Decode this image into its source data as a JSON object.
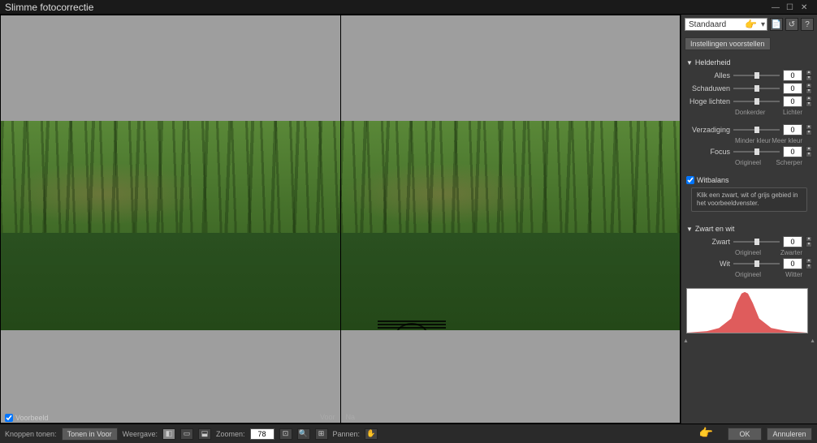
{
  "window": {
    "title": "Slimme fotocorrectie"
  },
  "preset": {
    "selected": "Standaard",
    "save_label": "Instellingen voorstellen"
  },
  "sections": {
    "brightness": {
      "title": "Helderheid",
      "all": {
        "label": "Alles",
        "value": "0"
      },
      "shadows": {
        "label": "Schaduwen",
        "value": "0"
      },
      "highlights": {
        "label": "Hoge lichten",
        "value": "0"
      },
      "range_low": "Donkerder",
      "range_high": "Lichter"
    },
    "saturation": {
      "label": "Verzadiging",
      "value": "0",
      "range_low": "Minder kleur",
      "range_high": "Meer kleur"
    },
    "focus": {
      "label": "Focus",
      "value": "0",
      "range_low": "Origineel",
      "range_high": "Scherper"
    },
    "wb": {
      "title": "Witbalans",
      "hint": "Klik een zwart, wit of grijs gebied in het voorbeeldvenster."
    },
    "bw": {
      "title": "Zwart en wit",
      "black": {
        "label": "Zwart",
        "value": "0",
        "range_low": "Origineel",
        "range_high": "Zwarter"
      },
      "white": {
        "label": "Wit",
        "value": "0",
        "range_low": "Origineel",
        "range_high": "Witter"
      }
    }
  },
  "image": {
    "before_label": "Voor",
    "after_label": "Na"
  },
  "footer": {
    "preview_label": "Voorbeeld",
    "buttons_label": "Knoppen tonen:",
    "show_in_before": "Tonen in Voor",
    "display_label": "Weergave:",
    "zoom_label": "Zoomen:",
    "zoom_value": "78",
    "pan_label": "Pannen:",
    "ok": "OK",
    "cancel": "Annuleren"
  }
}
